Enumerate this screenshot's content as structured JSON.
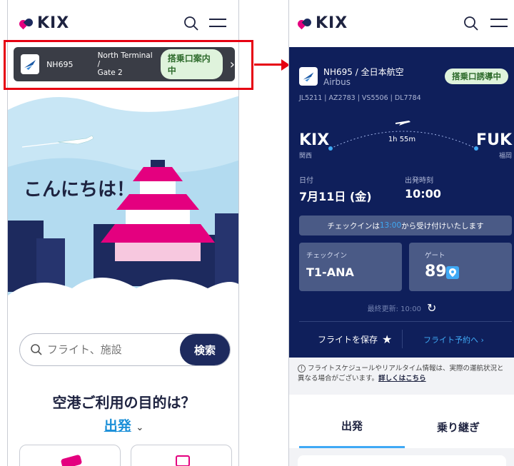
{
  "left": {
    "logo": "KIX",
    "banner": {
      "flight": "NH695",
      "terminal": "North Terminal /",
      "gate": "Gate 2",
      "status": "搭乗口案内中"
    },
    "hero": {
      "greeting": "こんにちは！"
    },
    "search": {
      "placeholder": "フライト、施設",
      "button": "検索"
    },
    "purpose": {
      "title": "空港ご利用の目的は？",
      "selected": "出発"
    }
  },
  "right": {
    "logo": "KIX",
    "flight": {
      "title": "NH695 / 全日本航空",
      "aircraft": "Airbus",
      "status": "搭乗口誘導中",
      "codeshares": "JL5211 | AZ2783 | VS5506 | DL7784",
      "duration": "1h 55m",
      "origin_code": "KIX",
      "origin_name": "関西",
      "dest_code": "FUK",
      "dest_name": "福岡",
      "date_label": "日付",
      "date_value": "7月11日 (金)",
      "time_label": "出発時刻",
      "time_value": "10:00",
      "checkin_notice_prefix": "チェックインは",
      "checkin_notice_time": "13:00",
      "checkin_notice_suffix": "から受け付けいたします",
      "checkin_label": "チェックイン",
      "checkin_value": "T1-ANA",
      "gate_label": "ゲート",
      "gate_value": "89",
      "last_updated": "最終更新: 10:00",
      "save_label": "フライトを保存",
      "book_label": "フライト予約へ ›"
    },
    "disclaimer": {
      "text": "フライトスケジュールやリアルタイム情報は、実際の運航状況と異なる場合がございます。",
      "link": "詳しくはこちら"
    },
    "tabs": [
      "出発",
      "乗り継ぎ"
    ]
  },
  "colors": {
    "navy": "#0f1f5b",
    "status_green_bg": "#dff3dc",
    "status_green_text": "#2e6b2c",
    "accent_blue": "#3fa9f5",
    "highlight_red": "#e60012"
  }
}
